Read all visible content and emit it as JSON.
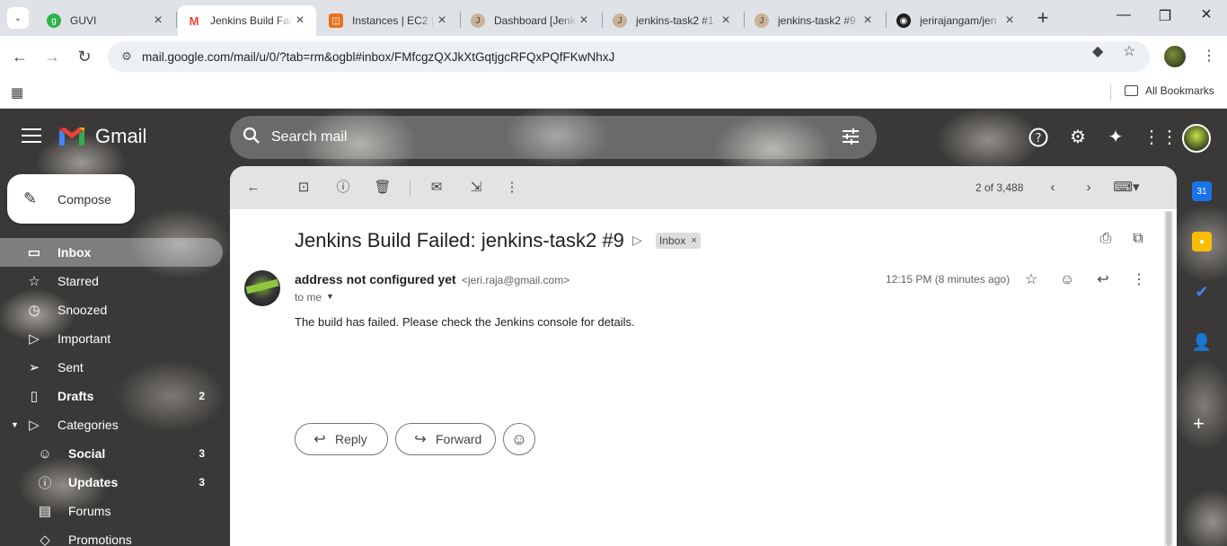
{
  "browser": {
    "tabs": [
      {
        "title": "GUVI",
        "fav_color": "#2db34a",
        "fav_text": "g"
      },
      {
        "title": "Jenkins Build Failed",
        "fav_color": "#ea4335",
        "fav_text": "M"
      },
      {
        "title": "Instances | EC2 |",
        "fav_color": "#e8711a",
        "fav_text": "◫"
      },
      {
        "title": "Dashboard [Jenk",
        "fav_color": "#8b5a3c",
        "fav_text": "J"
      },
      {
        "title": "jenkins-task2 #1",
        "fav_color": "#8b5a3c",
        "fav_text": "J"
      },
      {
        "title": "jenkins-task2 #9",
        "fav_color": "#8b5a3c",
        "fav_text": "J"
      },
      {
        "title": "jerirajangam/jen",
        "fav_color": "#1f1f1f",
        "fav_text": "◉"
      }
    ],
    "url": "mail.google.com/mail/u/0/?tab=rm&ogbl#inbox/FMfcgzQXJkXtGqtjgcRFQxPQfFKwNhxJ",
    "all_bookmarks": "All Bookmarks"
  },
  "gmail": {
    "logo_text": "Gmail",
    "search_placeholder": "Search mail",
    "compose_label": "Compose",
    "nav": [
      {
        "label": "Inbox",
        "icon": "▭",
        "count": "",
        "active": true
      },
      {
        "label": "Starred",
        "icon": "☆",
        "count": ""
      },
      {
        "label": "Snoozed",
        "icon": "◷",
        "count": ""
      },
      {
        "label": "Important",
        "icon": "▷",
        "count": ""
      },
      {
        "label": "Sent",
        "icon": "➢",
        "count": ""
      },
      {
        "label": "Drafts",
        "icon": "▯",
        "count": "2",
        "bold": true
      },
      {
        "label": "Categories",
        "icon": "▷",
        "count": ""
      },
      {
        "label": "Social",
        "icon": "☺",
        "count": "3",
        "bold": true,
        "sub": true
      },
      {
        "label": "Updates",
        "icon": "ⓘ",
        "count": "3",
        "bold": true,
        "sub": true
      },
      {
        "label": "Forums",
        "icon": "▤",
        "count": "",
        "sub": true
      },
      {
        "label": "Promotions",
        "icon": "◇",
        "count": "",
        "sub": true
      }
    ],
    "pager": "2 of 3,488",
    "email": {
      "subject": "Jenkins Build Failed: jenkins-task2 #9",
      "label": "Inbox",
      "sender_name": "address not configured yet",
      "sender_email": "<jeri.raja@gmail.com>",
      "to": "to me",
      "time": "12:15 PM (8 minutes ago)",
      "body": "The build has failed. Please check the Jenkins console for details."
    },
    "actions": {
      "reply": "Reply",
      "forward": "Forward"
    }
  }
}
